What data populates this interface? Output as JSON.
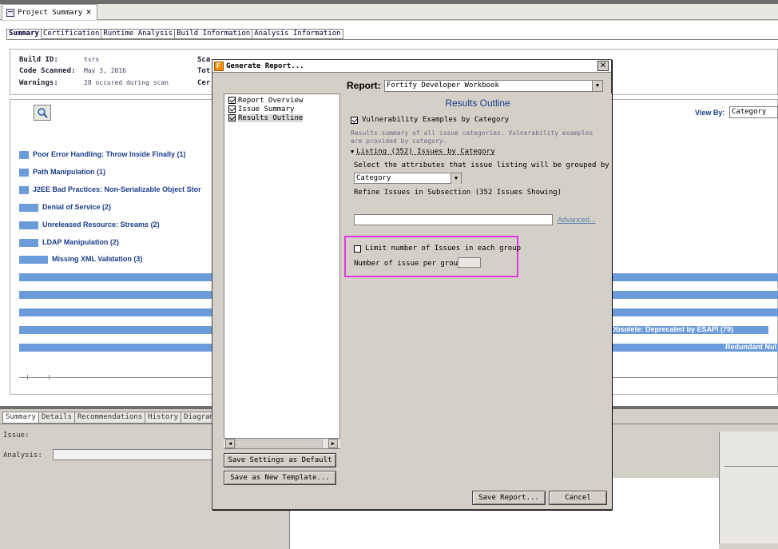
{
  "editor": {
    "tab_title": "Project Summary",
    "subtabs": [
      "Summary",
      "Certification",
      "Runtime Analysis",
      "Build Information",
      "Analysis Information"
    ],
    "info": {
      "build_id_label": "Build ID:",
      "build_id_value": "tsrs",
      "code_scanned_label": "Code Scanned:",
      "code_scanned_value": "May 3, 2016",
      "warnings_label": "Warnings:",
      "warnings_value": "28 occured during scan",
      "col2_labels": [
        "Sca",
        "Tot",
        "Cer"
      ]
    },
    "view_by_label": "View By:",
    "view_by_value": "Category"
  },
  "chart_data": {
    "type": "bar",
    "categories": [
      "Poor Error Handling: Throw Inside Finally",
      "Path Manipulation",
      "J2EE Bad Practices: Non-Serializable Object Stor",
      "Denial of Service",
      "Unreleased Resource: Streams",
      "LDAP Manipulation",
      "Missing XML Validation",
      "",
      "",
      "",
      "Obsolete: Deprecated by ESAPI",
      "Redundant Nul"
    ],
    "labels": [
      "Poor Error Handling: Throw Inside Finally (1)",
      "Path Manipulation (1)",
      "J2EE Bad Practices: Non-Serializable Object Stor",
      "Denial of Service (2)",
      "Unreleased Resource: Streams (2)",
      "LDAP Manipulation (2)",
      "Missing XML Validation (3)",
      "",
      "",
      "",
      "Obsolete: Deprecated by ESAPI (79)",
      "Redundant Nul"
    ],
    "values": [
      1,
      1,
      1,
      2,
      2,
      2,
      3,
      80,
      80,
      80,
      79,
      80
    ],
    "bar_color": "#6b9bd8"
  },
  "bottom": {
    "tabs": [
      "Summary",
      "Details",
      "Recommendations",
      "History",
      "Diagram"
    ],
    "issue_label": "Issue:",
    "analysis_label": "Analysis:"
  },
  "dialog": {
    "title": "Generate Report...",
    "sections": [
      {
        "label": "Report Overview",
        "checked": true
      },
      {
        "label": "Issue Summary",
        "checked": true
      },
      {
        "label": "Results Outline",
        "checked": true
      }
    ],
    "save_default_label": "Save Settings as Default",
    "save_template_label": "Save as New Template...",
    "report_label": "Report:",
    "report_value": "Fortify Developer Workbook",
    "outline_title": "Results Outline",
    "vuln_examples_label": "Vulnerability Examples by Category",
    "vuln_note_1": "Results summary of all issue categories.  Vulnerability examples",
    "vuln_note_2": "are provided by category.",
    "listing_label": "Listing (352) Issues by Category",
    "group_by_instruction": "Select the attributes that issue listing will be grouped by",
    "group_by_value": "Category",
    "refine_label": "Refine Issues in Subsection (352 Issues Showing)",
    "advanced_label": "Advanced...",
    "limit_label": "Limit number of Issues in each group",
    "per_group_label": "Number of issue per group:",
    "save_report_label": "Save Report...",
    "cancel_label": "Cancel",
    "highlight_color": "#e236e2"
  }
}
